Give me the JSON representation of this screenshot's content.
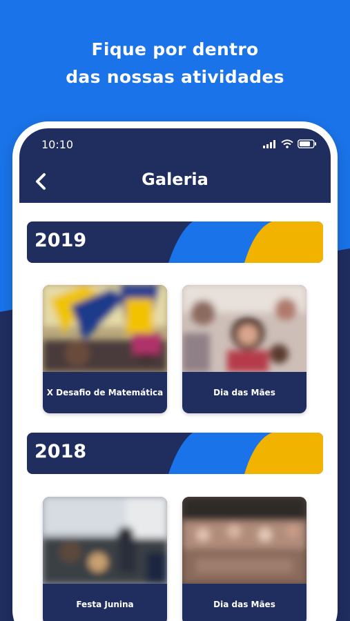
{
  "headline": {
    "line1": "Fique por dentro",
    "line2": "das nossas atividades"
  },
  "status_bar": {
    "time": "10:10",
    "icons": [
      "signal-icon",
      "wifi-icon",
      "battery-icon"
    ]
  },
  "nav": {
    "back_icon": "chevron-left-icon",
    "title": "Galeria"
  },
  "colors": {
    "background_blue": "#1a73e8",
    "navy": "#1f2d5f",
    "accent_blue": "#1a73e8",
    "accent_yellow": "#f2b300",
    "white": "#ffffff"
  },
  "sections": [
    {
      "year": "2019",
      "albums": [
        {
          "title": "X Desafio de Matemática"
        },
        {
          "title": "Dia das Mães"
        }
      ]
    },
    {
      "year": "2018",
      "albums": [
        {
          "title": "Festa Junina"
        },
        {
          "title": "Dia das Mães"
        }
      ]
    }
  ]
}
